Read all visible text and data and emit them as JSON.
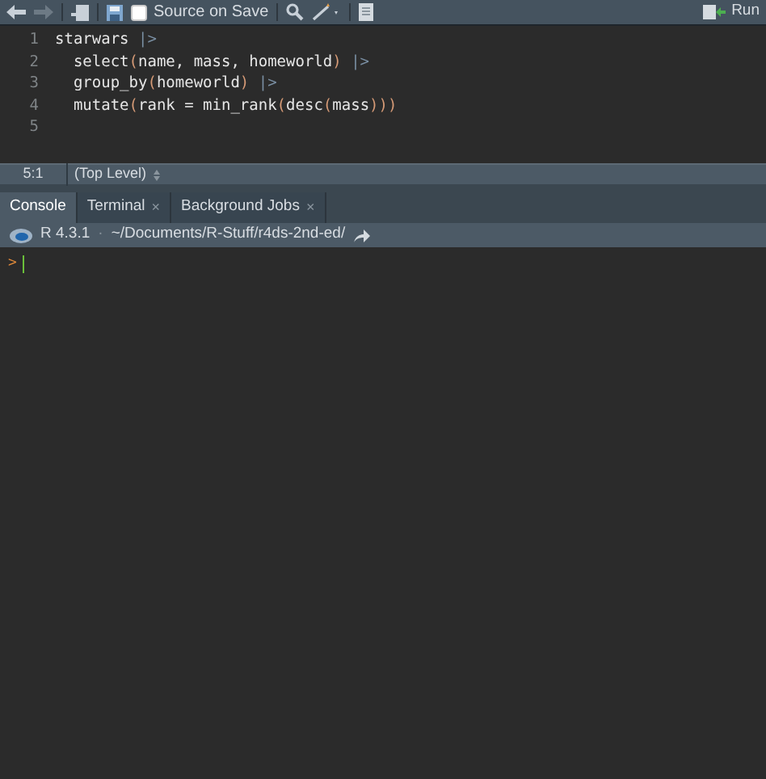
{
  "toolbar": {
    "source_on_save": {
      "label": "Source on Save",
      "checked": false
    },
    "run_label": "Run"
  },
  "editor": {
    "lines": [
      {
        "number": "1",
        "tokens": [
          {
            "kind": "plain",
            "text": "starwars "
          },
          {
            "kind": "pipe",
            "text": "|>"
          }
        ]
      },
      {
        "number": "2",
        "tokens": [
          {
            "kind": "plain",
            "text": "  select"
          },
          {
            "kind": "paren",
            "text": "("
          },
          {
            "kind": "plain",
            "text": "name, mass, homeworld"
          },
          {
            "kind": "paren",
            "text": ")"
          },
          {
            "kind": "pipe",
            "text": " |>"
          }
        ]
      },
      {
        "number": "3",
        "tokens": [
          {
            "kind": "plain",
            "text": "  group_by"
          },
          {
            "kind": "paren",
            "text": "("
          },
          {
            "kind": "plain",
            "text": "homeworld"
          },
          {
            "kind": "paren",
            "text": ")"
          },
          {
            "kind": "pipe",
            "text": " |>"
          }
        ]
      },
      {
        "number": "4",
        "tokens": [
          {
            "kind": "plain",
            "text": "  mutate"
          },
          {
            "kind": "paren",
            "text": "("
          },
          {
            "kind": "plain",
            "text": "rank = min_rank"
          },
          {
            "kind": "paren",
            "text": "("
          },
          {
            "kind": "plain",
            "text": "desc"
          },
          {
            "kind": "paren",
            "text": "("
          },
          {
            "kind": "plain",
            "text": "mass"
          },
          {
            "kind": "paren",
            "text": ")))"
          }
        ]
      },
      {
        "number": "5"
      }
    ]
  },
  "status_bar": {
    "position": "5:1",
    "scope": "(Top Level)"
  },
  "tabs": [
    {
      "label": "Console",
      "selected": true
    },
    {
      "label": "Terminal",
      "selected": false,
      "close": "×"
    },
    {
      "label": "Background Jobs",
      "selected": false,
      "close": "×"
    }
  ],
  "console": {
    "version": "R 4.3.1",
    "separator": "·",
    "path": "~/Documents/R-Stuff/r4ds-2nd-ed/",
    "prompt": ">"
  }
}
